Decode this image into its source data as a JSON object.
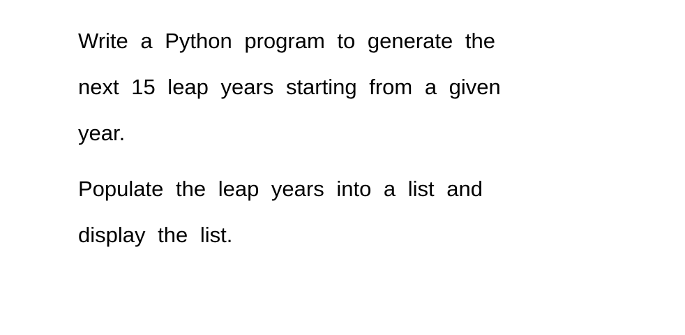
{
  "document": {
    "paragraphs": [
      {
        "lines": [
          "Write a Python program to generate the",
          "next 15 leap years starting from a given",
          "year."
        ]
      },
      {
        "lines": [
          "Populate the leap years into a list and",
          "display the list."
        ]
      }
    ]
  }
}
